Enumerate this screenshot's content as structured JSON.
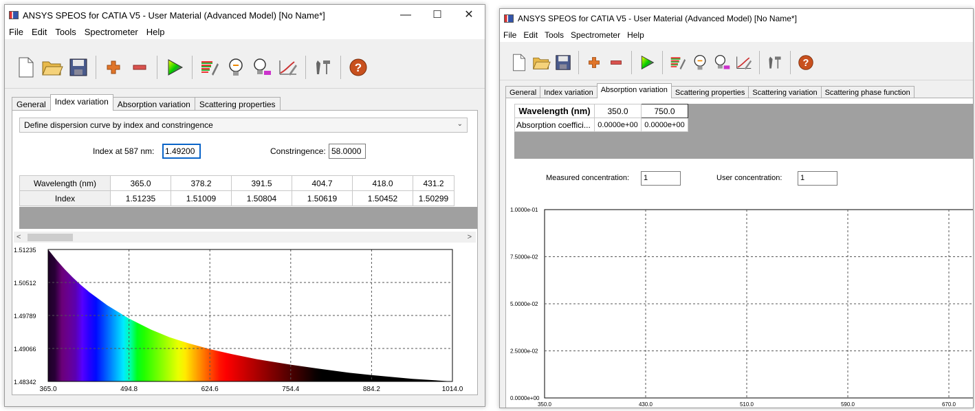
{
  "left_window": {
    "title": "ANSYS SPEOS for CATIA V5 - User Material (Advanced Model) [No Name*]",
    "menu": [
      "File",
      "Edit",
      "Tools",
      "Spectrometer",
      "Help"
    ],
    "tabs": [
      "General",
      "Index variation",
      "Absorption variation",
      "Scattering properties"
    ],
    "active_tab": "Index variation",
    "dispersion_select": "Define dispersion curve by index and constringence",
    "index_label": "Index at 587 nm:",
    "index_value": "1.49200",
    "constringence_label": "Constringence:",
    "constringence_value": "58.0000",
    "table": {
      "row_headers": [
        "Wavelength (nm)",
        "Index"
      ],
      "wavelengths": [
        "365.0",
        "378.2",
        "391.5",
        "404.7",
        "418.0",
        "431.2"
      ],
      "indices": [
        "1.51235",
        "1.51009",
        "1.50804",
        "1.50619",
        "1.50452",
        "1.50299"
      ]
    }
  },
  "right_window": {
    "title": "ANSYS SPEOS for CATIA V5 - User Material (Advanced Model) [No Name*]",
    "menu": [
      "File",
      "Edit",
      "Tools",
      "Spectrometer",
      "Help"
    ],
    "tabs": [
      "General",
      "Index variation",
      "Absorption variation",
      "Scattering properties",
      "Scattering variation",
      "Scattering phase function"
    ],
    "active_tab": "Absorption variation",
    "table": {
      "row_headers": [
        "Wavelength (nm)",
        "Absorption coeffici..."
      ],
      "wavelengths": [
        "350.0",
        "750.0"
      ],
      "coefficients": [
        "0.0000e+00",
        "0.0000e+00"
      ]
    },
    "measured_label": "Measured concentration:",
    "measured_value": "1",
    "user_label": "User concentration:",
    "user_value": "1"
  },
  "chart_data": [
    {
      "type": "area",
      "title": "",
      "xlabel": "",
      "ylabel": "",
      "xlim": [
        365.0,
        1014.0
      ],
      "ylim": [
        1.48342,
        1.51235
      ],
      "x_ticks": [
        "365.0",
        "494.8",
        "624.6",
        "754.4",
        "884.2",
        "1014.0"
      ],
      "y_ticks": [
        "1.51235",
        "1.50512",
        "1.49789",
        "1.49066",
        "1.48342"
      ],
      "fill": "visible spectrum colors under the curve",
      "grid": true,
      "series": [
        {
          "x": [
            365,
            378.2,
            391.5,
            404.7,
            418,
            431.2,
            460,
            494.8,
            530,
            560,
            590,
            624.6,
            660,
            700,
            754.4,
            800,
            850,
            884.2,
            950,
            1014
          ],
          "y": [
            1.51235,
            1.51009,
            1.50804,
            1.50619,
            1.50452,
            1.50299,
            1.5001,
            1.4972,
            1.4948,
            1.4931,
            1.4918,
            1.4905,
            1.4894,
            1.4883,
            1.4871,
            1.4862,
            1.4853,
            1.4848,
            1.484,
            1.48342
          ]
        }
      ]
    },
    {
      "type": "line",
      "title": "",
      "xlabel": "",
      "ylabel": "",
      "xlim": [
        350.0,
        720.0
      ],
      "ylim": [
        0.0,
        0.1
      ],
      "x_ticks": [
        "350.0",
        "430.0",
        "510.0",
        "590.0",
        "670.0"
      ],
      "y_ticks": [
        "1.0000e-01",
        "7.5000e-02",
        "5.0000e-02",
        "2.5000e-02",
        "0.0000e+00"
      ],
      "grid": true,
      "series": []
    }
  ]
}
